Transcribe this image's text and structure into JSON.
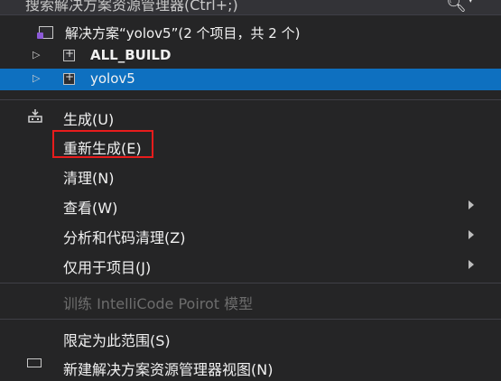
{
  "search": {
    "placeholder": "搜索解决方案资源管理器(Ctrl+;)"
  },
  "tree": {
    "solution_label": "解决方案“yolov5”(2 个项目，共 2 个)",
    "projects": [
      {
        "label": "ALL_BUILD",
        "selected": false
      },
      {
        "label": "yolov5",
        "selected": true
      }
    ]
  },
  "menu": {
    "items": [
      {
        "label": "生成(U)"
      },
      {
        "label": "重新生成(E)"
      },
      {
        "label": "清理(N)"
      },
      {
        "label": "查看(W)"
      },
      {
        "label": "分析和代码清理(Z)"
      },
      {
        "label": "仅用于项目(J)"
      },
      {
        "label": "训练 IntelliCode Poirot 模型"
      },
      {
        "label": "限定为此范围(S)"
      },
      {
        "label": "新建解决方案资源管理器视图(N)"
      }
    ]
  },
  "colors": {
    "background": "#252526",
    "selection": "#0e70c0",
    "highlight_box": "#e81c1c"
  }
}
